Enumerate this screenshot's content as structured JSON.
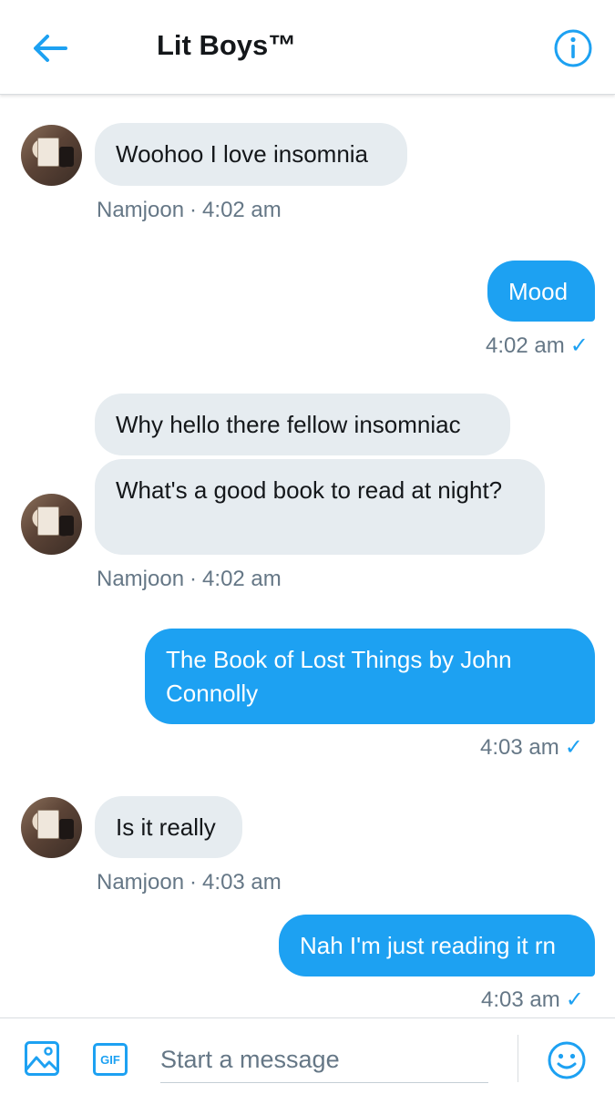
{
  "header": {
    "title": "Lit Boys™",
    "back_icon": "arrow-left-icon",
    "info_icon": "info-icon"
  },
  "conversation": [
    {
      "id": "m1",
      "direction": "incoming",
      "text": "Woohoo I love insomnia"
    },
    {
      "id": "m1meta",
      "sender": "Namjoon",
      "separator": "·",
      "time": "4:02 am"
    },
    {
      "id": "m2",
      "direction": "outgoing",
      "text": "Mood"
    },
    {
      "id": "m2meta",
      "time": "4:02 am",
      "status": "✓"
    },
    {
      "id": "m3",
      "direction": "incoming",
      "text": "Why hello there fellow insomniac"
    },
    {
      "id": "m4",
      "direction": "incoming",
      "text": "What's a good book to read at night?"
    },
    {
      "id": "m4meta",
      "sender": "Namjoon",
      "separator": "·",
      "time": "4:02 am"
    },
    {
      "id": "m5",
      "direction": "outgoing",
      "text": "The Book of Lost Things by John Connolly"
    },
    {
      "id": "m5meta",
      "time": "4:03 am",
      "status": "✓"
    },
    {
      "id": "m6",
      "direction": "incoming",
      "text": "Is it really"
    },
    {
      "id": "m6meta",
      "sender": "Namjoon",
      "separator": "·",
      "time": "4:03 am"
    },
    {
      "id": "m7",
      "direction": "outgoing",
      "text": "Nah I'm just reading it rn"
    },
    {
      "id": "m7meta",
      "time": "4:03 am",
      "status": "✓"
    }
  ],
  "composer": {
    "placeholder": "Start a message",
    "gif_label": "GIF",
    "media_icon": "image-icon",
    "emoji_icon": "smiley-icon"
  },
  "colors": {
    "accent": "#1da1f2",
    "incoming_bubble": "#e6ecf0",
    "meta_text": "#657786",
    "text": "#14171a"
  }
}
